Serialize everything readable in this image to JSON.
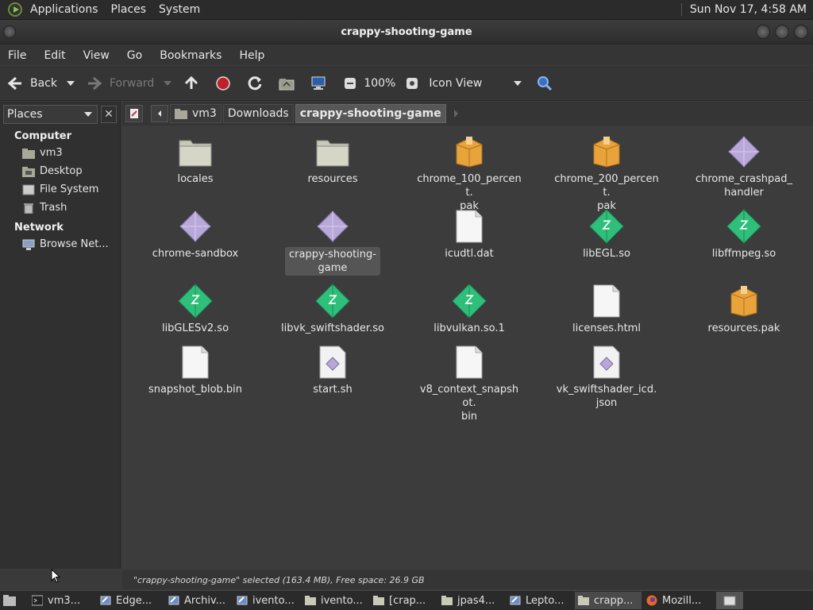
{
  "top_panel": {
    "menus": [
      "Applications",
      "Places",
      "System"
    ],
    "clock": "Sun Nov 17,  4:58 AM"
  },
  "window": {
    "title": "crappy-shooting-game"
  },
  "menubar": [
    "File",
    "Edit",
    "View",
    "Go",
    "Bookmarks",
    "Help"
  ],
  "toolbar": {
    "back_label": "Back",
    "forward_label": "Forward",
    "zoom": "100%",
    "view_mode": "Icon View"
  },
  "sidebar": {
    "selector_label": "Places",
    "sections": [
      {
        "title": "Computer",
        "items": [
          "vm3",
          "Desktop",
          "File System",
          "Trash"
        ]
      },
      {
        "title": "Network",
        "items": [
          "Browse Net..."
        ]
      }
    ]
  },
  "location": {
    "crumbs": [
      "vm3",
      "Downloads",
      "crappy-shooting-game"
    ]
  },
  "files": [
    {
      "name": "locales",
      "icon": "folder-icon"
    },
    {
      "name": "resources",
      "icon": "folder-icon"
    },
    {
      "name": "chrome_100_percent.\npak",
      "icon": "package-icon"
    },
    {
      "name": "chrome_200_percent.\npak",
      "icon": "package-icon"
    },
    {
      "name": "chrome_crashpad_\nhandler",
      "icon": "executable-icon"
    },
    {
      "name": "chrome-sandbox",
      "icon": "executable-icon"
    },
    {
      "name": "crappy-shooting-\ngame",
      "icon": "executable-icon",
      "selected": true
    },
    {
      "name": "icudtl.dat",
      "icon": "document-icon"
    },
    {
      "name": "libEGL.so",
      "icon": "library-icon"
    },
    {
      "name": "libffmpeg.so",
      "icon": "library-icon"
    },
    {
      "name": "libGLESv2.so",
      "icon": "library-icon"
    },
    {
      "name": "libvk_swiftshader.so",
      "icon": "library-icon"
    },
    {
      "name": "libvulkan.so.1",
      "icon": "library-icon"
    },
    {
      "name": "licenses.html",
      "icon": "document-icon"
    },
    {
      "name": "resources.pak",
      "icon": "package-icon"
    },
    {
      "name": "snapshot_blob.bin",
      "icon": "document-icon"
    },
    {
      "name": "start.sh",
      "icon": "script-icon"
    },
    {
      "name": "v8_context_snapshot.\nbin",
      "icon": "document-icon"
    },
    {
      "name": "vk_swiftshader_icd.\njson",
      "icon": "script-icon"
    }
  ],
  "statusbar": {
    "text": "\"crappy-shooting-game\" selected (163.4 MB), Free space: 26.9 GB"
  },
  "taskbar": {
    "tasks": [
      {
        "label": "vm3...",
        "icon": "terminal-icon"
      },
      {
        "label": "Edge...",
        "icon": "editor-icon"
      },
      {
        "label": "Archiv...",
        "icon": "editor-icon"
      },
      {
        "label": "ivento...",
        "icon": "editor-icon"
      },
      {
        "label": "ivento...",
        "icon": "folder-icon"
      },
      {
        "label": "[crap...",
        "icon": "folder-icon"
      },
      {
        "label": "jpas4...",
        "icon": "folder-icon"
      },
      {
        "label": "Lepto...",
        "icon": "editor-icon"
      },
      {
        "label": "crapp...",
        "icon": "folder-icon",
        "active": true
      },
      {
        "label": "Mozill...",
        "icon": "firefox-icon"
      }
    ]
  },
  "colors": {
    "folder": "#c9c9b8",
    "package": "#e8a33a",
    "library": "#2fbf7a",
    "executable": "#b8a8d8"
  }
}
